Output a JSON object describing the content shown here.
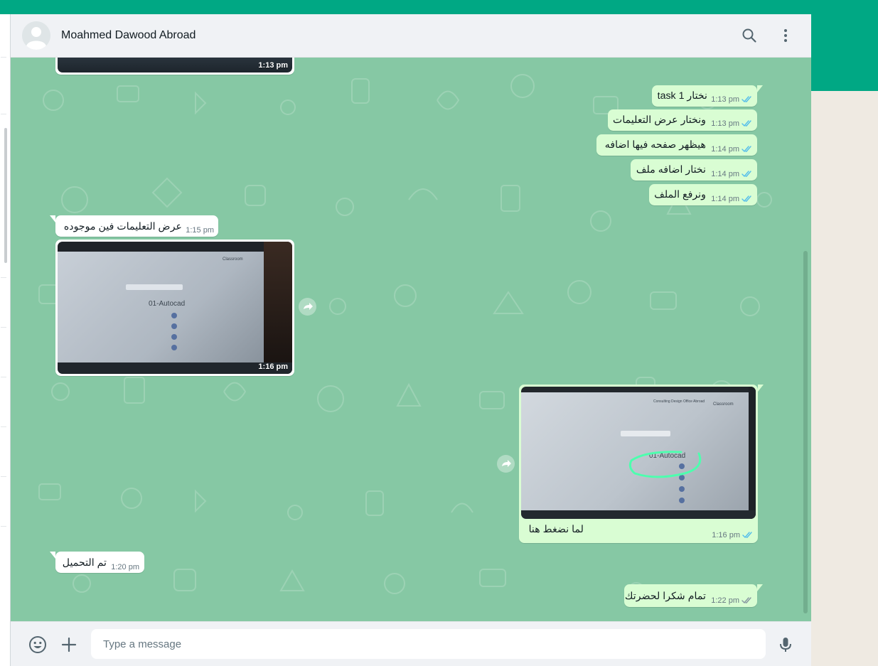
{
  "colors": {
    "accent": "#00a884",
    "chat_background": "#86c8a4",
    "outgoing_bubble": "#d9fdd3",
    "incoming_bubble": "#ffffff",
    "read_ticks": "#53bdeb",
    "delivered_ticks": "#8696a0"
  },
  "header": {
    "contact_name": "Moahmed Dawood Abroad",
    "icons": [
      "avatar-icon",
      "search-icon",
      "menu-icon"
    ]
  },
  "messages": [
    {
      "id": "m0",
      "direction": "in",
      "type": "image",
      "time": "1:13 pm",
      "note": "partial"
    },
    {
      "id": "m1",
      "direction": "out",
      "type": "text",
      "text": "نختار task 1",
      "time": "1:13 pm",
      "status": "read"
    },
    {
      "id": "m2",
      "direction": "out",
      "type": "text",
      "text": "ونختار عرض التعليمات",
      "time": "1:13 pm",
      "status": "read"
    },
    {
      "id": "m3",
      "direction": "out",
      "type": "text",
      "text": "هيظهر صفحه فيها اضافه",
      "time": "1:14 pm",
      "status": "read"
    },
    {
      "id": "m4",
      "direction": "out",
      "type": "text",
      "text": "نختار اضافه ملف",
      "time": "1:14 pm",
      "status": "read"
    },
    {
      "id": "m5",
      "direction": "out",
      "type": "text",
      "text": "ونرفع الملف",
      "time": "1:14 pm",
      "status": "read"
    },
    {
      "id": "m6",
      "direction": "in",
      "type": "text",
      "text": "عرض التعليمات فين موجوده",
      "time": "1:15 pm"
    },
    {
      "id": "m7",
      "direction": "in",
      "type": "image",
      "time": "1:16 pm",
      "image_texts": [
        "01-Autocad",
        "Classroom"
      ]
    },
    {
      "id": "m8",
      "direction": "out",
      "type": "image",
      "caption": "لما نضغط هنا",
      "time": "1:16 pm",
      "status": "read",
      "image_texts": [
        "01-Autocad",
        "Classroom",
        "Consulting Design Office Abroad"
      ]
    },
    {
      "id": "m9",
      "direction": "in",
      "type": "text",
      "text": "تم التحميل",
      "time": "1:20 pm"
    },
    {
      "id": "m10",
      "direction": "out",
      "type": "text",
      "text": "تمام شكرا لحضرتك",
      "time": "1:22 pm",
      "status": "delivered"
    }
  ],
  "composer": {
    "placeholder": "Type a message",
    "icons": [
      "emoji-icon",
      "attach-plus-icon",
      "microphone-icon"
    ]
  }
}
